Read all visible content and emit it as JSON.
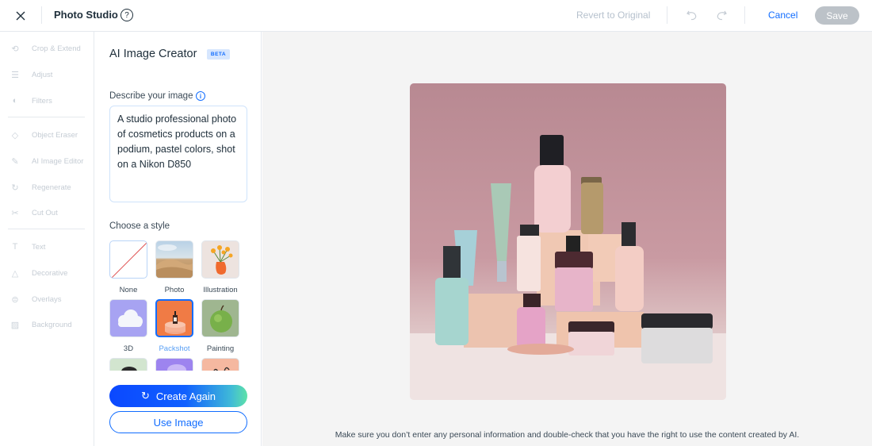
{
  "header": {
    "title": "Photo Studio",
    "revert_label": "Revert to Original",
    "cancel_label": "Cancel",
    "save_label": "Save",
    "help_icon": "question-circle-icon",
    "help_glyph": "?"
  },
  "sidebar": {
    "groups": [
      [
        {
          "label": "Crop & Extend",
          "icon": "crop-icon",
          "glyph": "⟲"
        },
        {
          "label": "Adjust",
          "icon": "sliders-icon",
          "glyph": "☰"
        },
        {
          "label": "Filters",
          "icon": "filters-icon",
          "glyph": "◐"
        }
      ],
      [
        {
          "label": "Object Eraser",
          "icon": "eraser-icon",
          "glyph": "◇"
        },
        {
          "label": "AI Image Editor",
          "icon": "brush-icon",
          "glyph": "✎"
        },
        {
          "label": "Regenerate",
          "icon": "regenerate-icon",
          "glyph": "↻"
        },
        {
          "label": "Cut Out",
          "icon": "scissors-icon",
          "glyph": "✂"
        }
      ],
      [
        {
          "label": "Text",
          "icon": "text-icon",
          "glyph": "T"
        },
        {
          "label": "Decorative",
          "icon": "shapes-icon",
          "glyph": "△"
        },
        {
          "label": "Overlays",
          "icon": "overlays-icon",
          "glyph": "⊜"
        },
        {
          "label": "Background",
          "icon": "background-icon",
          "glyph": "▨"
        }
      ]
    ]
  },
  "panel": {
    "title": "AI Image Creator",
    "badge": "BETA",
    "describe_label": "Describe your image",
    "info_glyph": "i",
    "prompt_value": "A studio professional photo of cosmetics products on a podium, pastel colors, shot on a Nikon D850",
    "style_label": "Choose a style",
    "styles": [
      {
        "label": "None",
        "selected": false
      },
      {
        "label": "Photo",
        "selected": false
      },
      {
        "label": "Illustration",
        "selected": false
      },
      {
        "label": "3D",
        "selected": false
      },
      {
        "label": "Packshot",
        "selected": true
      },
      {
        "label": "Painting",
        "selected": false
      },
      {
        "label": "",
        "selected": false
      },
      {
        "label": "",
        "selected": false
      },
      {
        "label": "",
        "selected": false
      }
    ],
    "create_again_label": "Create Again",
    "use_image_label": "Use Image"
  },
  "canvas": {
    "image_alt": "Cosmetics products on pastel podiums against a pink background",
    "disclaimer": "Make sure you don’t enter any personal information and double-check that you have the right to use the content created by AI."
  }
}
